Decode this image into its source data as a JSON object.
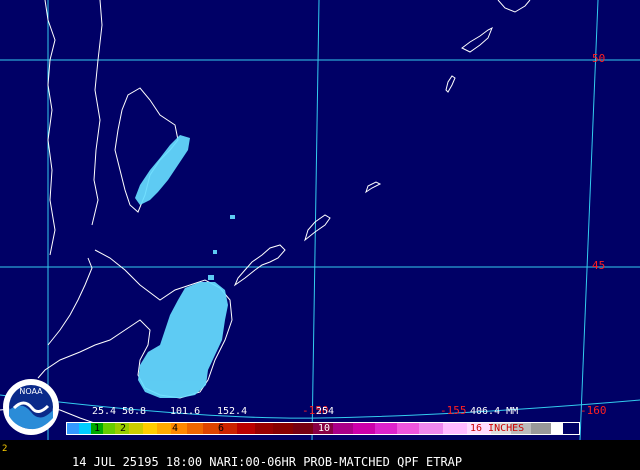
{
  "map": {
    "lat_labels": [
      {
        "text": "50",
        "value": 50
      },
      {
        "text": "45",
        "value": 45
      }
    ],
    "lon_labels": [
      {
        "text": "-150",
        "value": -150
      },
      {
        "text": "-155",
        "value": -155
      },
      {
        "text": "-160",
        "value": -160
      }
    ]
  },
  "legend": {
    "mm_ticks": [
      "25.4",
      "50.8",
      "101.6",
      "152.4",
      "254",
      "406.4 MM"
    ],
    "inch_ticks": [
      "1",
      "2",
      "4",
      "6",
      "10",
      "16 INCHES"
    ],
    "colors": {
      "ocean": "#000066",
      "grid": "#33ccee",
      "coast": "#ffffff",
      "precip": "#66ddff",
      "grid_label": "#ff2020"
    }
  },
  "footer": {
    "title": "14 JUL 25195 18:00 NARI:00-06HR PROB-MATCHED QPF ETRAP"
  },
  "logo": {
    "text": "NOAA",
    "icon": "noaa-logo-icon"
  },
  "corner_mark": "2"
}
